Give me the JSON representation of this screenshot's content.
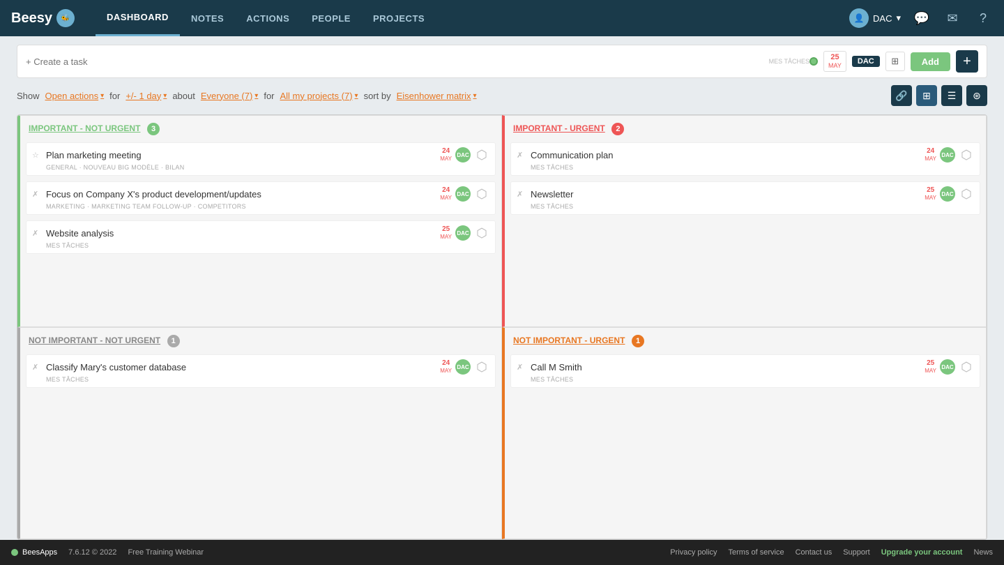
{
  "app": {
    "name": "Beesy",
    "version": "7.6.12 © 2022"
  },
  "nav": {
    "links": [
      "DASHBOARD",
      "NOTES",
      "ACTIONS",
      "PEOPLE",
      "PROJECTS"
    ],
    "active": "DASHBOARD",
    "user": "DAC",
    "free_training": "Free Training Webinar"
  },
  "taskbar": {
    "placeholder": "+ Create a task",
    "sublabel": "MES TÂCHES",
    "date_num": "25",
    "date_mon": "MAY",
    "tag": "DAC",
    "add_label": "Add"
  },
  "filters": {
    "show_label": "Show",
    "actions_label": "Open actions",
    "for1_label": "for",
    "period_label": "+/- 1 day",
    "about_label": "about",
    "people_label": "Everyone (7)",
    "for2_label": "for",
    "projects_label": "All my projects (7)",
    "sort_label": "sort by",
    "sort_value": "Eisenhower matrix"
  },
  "quadrants": {
    "top_left": {
      "title": "IMPORTANT - NOT URGENT",
      "badge": "3",
      "badge_type": "green",
      "tasks": [
        {
          "title": "Plan marketing meeting",
          "sub": "GENERAL · NOUVEAU BIG MODÈLE · BILAN",
          "date_num": "24",
          "date_mon": "MAY",
          "avatar": "DAC",
          "overdue": true
        },
        {
          "title": "Focus on Company X's product development/updates",
          "sub": "MARKETING · MARKETING TEAM FOLLOW-UP · COMPETITORS",
          "date_num": "24",
          "date_mon": "MAY",
          "avatar": "DAC",
          "overdue": true
        },
        {
          "title": "Website analysis",
          "sub": "MES TÂCHES",
          "date_num": "25",
          "date_mon": "MAY",
          "avatar": "DAC",
          "overdue": false
        }
      ]
    },
    "top_right": {
      "title": "IMPORTANT - URGENT",
      "badge": "2",
      "badge_type": "red",
      "tasks": [
        {
          "title": "Communication plan",
          "sub": "MES TÂCHES",
          "date_num": "24",
          "date_mon": "MAY",
          "avatar": "DAC",
          "overdue": true
        },
        {
          "title": "Newsletter",
          "sub": "MES TÂCHES",
          "date_num": "25",
          "date_mon": "MAY",
          "avatar": "DAC",
          "overdue": false
        }
      ]
    },
    "bottom_left": {
      "title": "NOT IMPORTANT - NOT URGENT",
      "badge": "1",
      "badge_type": "gray",
      "tasks": [
        {
          "title": "Classify Mary's customer database",
          "sub": "MES TÂCHES",
          "date_num": "24",
          "date_mon": "MAY",
          "avatar": "DAC",
          "overdue": true
        }
      ]
    },
    "bottom_right": {
      "title": "NOT IMPORTANT - URGENT",
      "badge": "1",
      "badge_type": "orange",
      "tasks": [
        {
          "title": "Call M Smith",
          "sub": "MES TÂCHES",
          "date_num": "25",
          "date_mon": "MAY",
          "avatar": "DAC",
          "overdue": false
        }
      ]
    }
  },
  "footer": {
    "brand": "BeesApps",
    "version": "7.6.12 © 2022",
    "training": "Free Training Webinar",
    "privacy": "Privacy policy",
    "terms": "Terms of service",
    "contact": "Contact us",
    "support": "Support",
    "upgrade": "Upgrade your account",
    "news": "News"
  }
}
